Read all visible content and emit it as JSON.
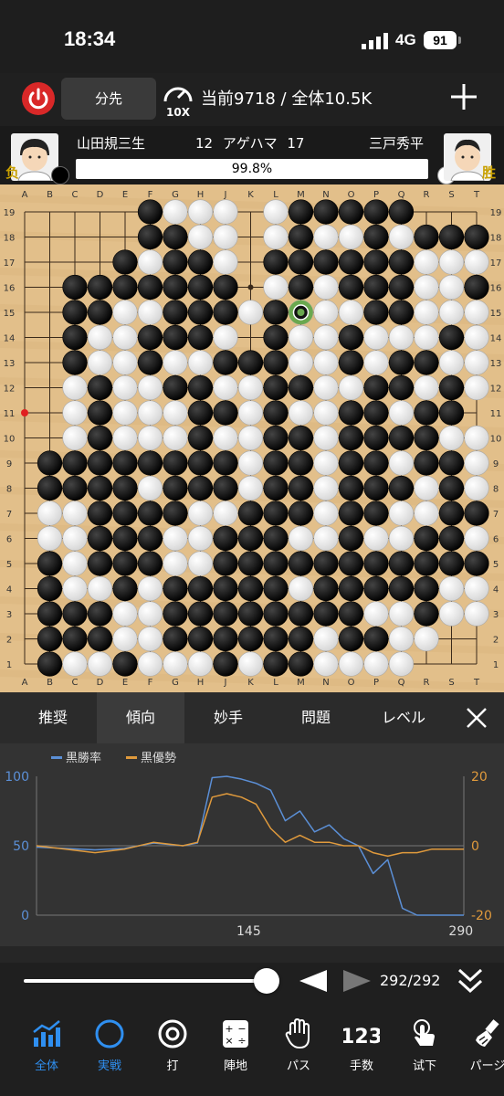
{
  "status_bar": {
    "time": "18:34",
    "network": "4G",
    "battery": "91"
  },
  "top_bar": {
    "first_move_label": "分先",
    "speed_label": "10X",
    "counts": "当前9718 / 全体10.5K"
  },
  "players": {
    "black": {
      "name": "山田規三生",
      "captures": "12",
      "result": "负"
    },
    "white": {
      "name": "三戸秀平",
      "captures": "17",
      "result": "胜"
    },
    "captures_label": "アゲハマ",
    "win_rate": "99.8%"
  },
  "board": {
    "columns": [
      "A",
      "B",
      "C",
      "D",
      "E",
      "F",
      "G",
      "H",
      "J",
      "K",
      "L",
      "M",
      "N",
      "O",
      "P",
      "Q",
      "R",
      "S",
      "T"
    ],
    "rows": [
      "19",
      "18",
      "17",
      "16",
      "15",
      "14",
      "13",
      "12",
      "11",
      "10",
      "9",
      "8",
      "7",
      "6",
      "5",
      "4",
      "3",
      "2",
      "1"
    ],
    "grid": [
      ".....bwww.wbbbbb...",
      ".....bbww.wbwwbwbbbb",
      "....bwbbw.bbbbbbwwwx",
      "..bbbbbbb.wbwbbbwwbw",
      "..bbwwbbbwbwwwbbwwwb",
      "..bwwbbbw.bwwbwwwbw",
      "..bwwbwwbbbwwbwbbww",
      "..wbwwbbwwbbwwbbwbw",
      "..wbwwwbbwbwwbbwbb.",
      "..wbwwwbwwbbwbbbbww",
      ".bbbbbbbbwbbwbbwbbw",
      ".bbbbwbbbwbbwbbbwbw",
      ".wwbbbbwwbbbwbbwwbb",
      ".wwbbbwwbbbwwbwwbbw",
      ".bwbbbwwbbbbbbbbbbb",
      ".bwwbwbbbbbwbbbbbww",
      ".bbbwwbbbbbbbbwwbww",
      ".bbbwwbbbbbbwbbww..",
      ".bwwbwwwbwbbwwww..."
    ],
    "last_move": "M15",
    "marker_red": "A11",
    "suggestions": [
      "N14",
      "O14",
      "H13",
      "H7",
      "J6",
      "M7",
      "N8",
      "L12"
    ]
  },
  "tabs": [
    {
      "label": "推奨"
    },
    {
      "label": "傾向"
    },
    {
      "label": "妙手"
    },
    {
      "label": "問題"
    },
    {
      "label": "レベル"
    }
  ],
  "chart_data": {
    "type": "line",
    "title": "",
    "legend": [
      "黒勝率",
      "黒優勢"
    ],
    "legend_placement": "top-left",
    "x_ticks": [
      "145",
      "290"
    ],
    "y_left_ticks": [
      "100",
      "50",
      "0"
    ],
    "y_right_ticks": [
      "20",
      "0",
      "-20"
    ],
    "ylim_left": [
      0,
      100
    ],
    "ylim_right": [
      -20,
      20
    ],
    "xlim": [
      0,
      292
    ],
    "series": [
      {
        "name": "黒勝率",
        "color": "#5b8fd6",
        "axis": "left",
        "x": [
          0,
          20,
          40,
          60,
          80,
          100,
          110,
          120,
          130,
          140,
          150,
          160,
          170,
          180,
          190,
          200,
          210,
          220,
          230,
          240,
          250,
          260,
          270,
          280,
          292
        ],
        "values": [
          49,
          48,
          47,
          48,
          52,
          50,
          52,
          99,
          100,
          98,
          95,
          90,
          68,
          75,
          60,
          65,
          55,
          50,
          30,
          40,
          5,
          0,
          0,
          0,
          0
        ]
      },
      {
        "name": "黒優勢",
        "color": "#e09a3c",
        "axis": "right",
        "x": [
          0,
          20,
          40,
          60,
          80,
          100,
          110,
          120,
          130,
          140,
          150,
          160,
          170,
          180,
          190,
          200,
          210,
          220,
          230,
          240,
          250,
          260,
          270,
          280,
          292
        ],
        "values": [
          0,
          -1,
          -2,
          -1,
          1,
          0,
          1,
          14,
          15,
          14,
          12,
          5,
          1,
          3,
          1,
          1,
          0,
          0,
          -2,
          -3,
          -2,
          -2,
          -1,
          -1,
          -1
        ]
      }
    ]
  },
  "navigation": {
    "move_counter": "292/292"
  },
  "toolbar": [
    {
      "label": "全体",
      "icon": "chart-icon",
      "active": true
    },
    {
      "label": "実戦",
      "icon": "circle-icon",
      "active": true
    },
    {
      "label": "打",
      "icon": "target-icon",
      "active": false
    },
    {
      "label": "陣地",
      "icon": "calculator-icon",
      "active": false
    },
    {
      "label": "パス",
      "icon": "hand-icon",
      "active": false
    },
    {
      "label": "手数",
      "icon": "numbers-icon",
      "active": false
    },
    {
      "label": "试下",
      "icon": "tap-icon",
      "active": false
    },
    {
      "label": "パージ",
      "icon": "brush-icon",
      "active": false
    }
  ]
}
